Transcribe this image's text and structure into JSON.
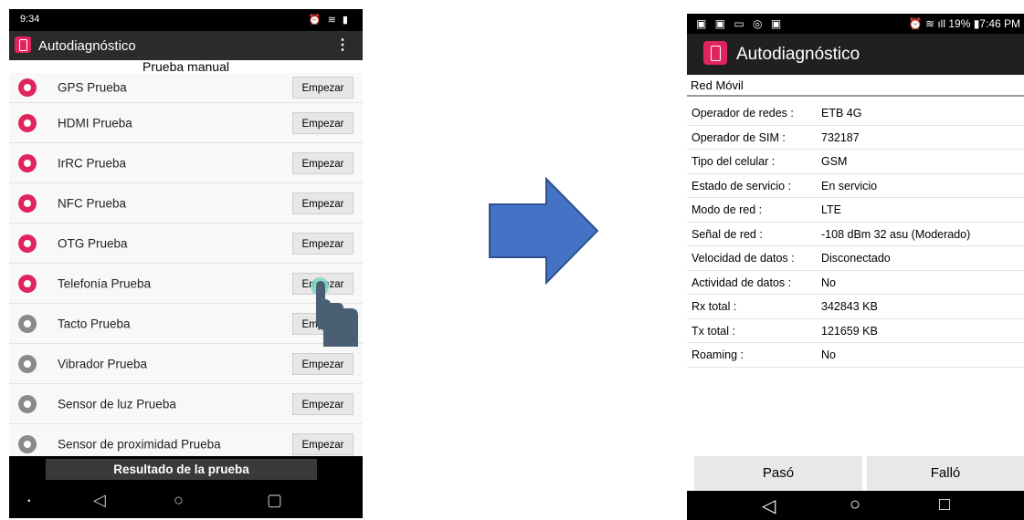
{
  "left": {
    "status_time": "9:34",
    "status_icons": "⏰ ≋ ▮",
    "app_title": "Autodiagnóstico",
    "menu_glyph": "⋮",
    "subheader": "Prueba manual",
    "button_label": "Empezar",
    "rows": [
      {
        "label": "GPS Prueba",
        "icon": "gps-icon"
      },
      {
        "label": "HDMI Prueba",
        "icon": "hdmi-icon"
      },
      {
        "label": "IrRC Prueba",
        "icon": "irrc-icon"
      },
      {
        "label": "NFC Prueba",
        "icon": "nfc-icon"
      },
      {
        "label": "OTG Prueba",
        "icon": "otg-icon"
      },
      {
        "label": "Telefonía Prueba",
        "icon": "telephony-icon"
      },
      {
        "label": "Tacto Prueba",
        "icon": "touch-icon"
      },
      {
        "label": "Vibrador Prueba",
        "icon": "vibrator-icon"
      },
      {
        "label": "Sensor de luz Prueba",
        "icon": "light-sensor-icon"
      },
      {
        "label": "Sensor de proximidad Prueba",
        "icon": "proximity-sensor-icon"
      }
    ],
    "result_button": "Resultado de la prueba",
    "nav": {
      "back": "◁",
      "home": "○",
      "recent": "▢",
      "dot": "▪"
    }
  },
  "right": {
    "status_left": "▣ ▣ ▭ ◎ ▣",
    "status_right": "⏰ ≋ ıll 19% ▮7:46 PM",
    "app_title": "Autodiagnóstico",
    "section_title": "Red Móvil",
    "info": [
      {
        "key": "Operador de redes :",
        "value": "ETB 4G"
      },
      {
        "key": "Operador de SIM :",
        "value": "732187"
      },
      {
        "key": "Tipo del celular :",
        "value": "GSM"
      },
      {
        "key": "Estado de servicio :",
        "value": "En servicio"
      },
      {
        "key": "Modo de red :",
        "value": "LTE"
      },
      {
        "key": "Señal de red :",
        "value": "-108 dBm 32 asu (Moderado)"
      },
      {
        "key": "Velocidad de datos :",
        "value": "Disconectado"
      },
      {
        "key": "Actividad de datos :",
        "value": "No"
      },
      {
        "key": "Rx total :",
        "value": "342843 KB"
      },
      {
        "key": "Tx total :",
        "value": "121659 KB"
      },
      {
        "key": "Roaming :",
        "value": "No"
      }
    ],
    "pass_label": "Pasó",
    "fail_label": "Falló",
    "nav": {
      "back": "◁",
      "home": "○",
      "recent": "□"
    }
  },
  "colors": {
    "accent": "#e0245e",
    "arrow": "#4472c4"
  }
}
